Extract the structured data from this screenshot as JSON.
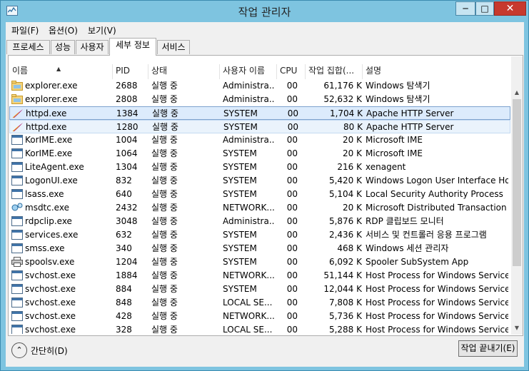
{
  "window": {
    "title": "작업 관리자"
  },
  "menu": {
    "file": "파일(F)",
    "options": "옵션(O)",
    "view": "보기(V)"
  },
  "tabs": [
    "프로세스",
    "성능",
    "사용자",
    "세부 정보",
    "서비스"
  ],
  "columns": {
    "name": "이름",
    "pid": "PID",
    "status": "상태",
    "user": "사용자 이름",
    "cpu": "CPU",
    "memory": "작업 집합(...",
    "description": "설명"
  },
  "processes": [
    {
      "name": "explorer.exe",
      "pid": "2688",
      "status": "실행 중",
      "user": "Administra...",
      "cpu": "00",
      "memory": "61,176 K",
      "description": "Windows 탐색기",
      "icon": "folder-icon"
    },
    {
      "name": "explorer.exe",
      "pid": "2808",
      "status": "실행 중",
      "user": "Administra...",
      "cpu": "00",
      "memory": "52,632 K",
      "description": "Windows 탐색기",
      "icon": "folder-icon"
    },
    {
      "name": "httpd.exe",
      "pid": "1384",
      "status": "실행 중",
      "user": "SYSTEM",
      "cpu": "00",
      "memory": "1,704 K",
      "description": "Apache HTTP Server",
      "icon": "apache-feather-icon"
    },
    {
      "name": "httpd.exe",
      "pid": "1280",
      "status": "실행 중",
      "user": "SYSTEM",
      "cpu": "00",
      "memory": "80 K",
      "description": "Apache HTTP Server",
      "icon": "apache-feather-icon"
    },
    {
      "name": "KorIME.exe",
      "pid": "1004",
      "status": "실행 중",
      "user": "Administra...",
      "cpu": "00",
      "memory": "20 K",
      "description": "Microsoft IME",
      "icon": "app-window-icon"
    },
    {
      "name": "KorIME.exe",
      "pid": "1064",
      "status": "실행 중",
      "user": "SYSTEM",
      "cpu": "00",
      "memory": "20 K",
      "description": "Microsoft IME",
      "icon": "app-window-icon"
    },
    {
      "name": "LiteAgent.exe",
      "pid": "1304",
      "status": "실행 중",
      "user": "SYSTEM",
      "cpu": "00",
      "memory": "216 K",
      "description": "xenagent",
      "icon": "app-window-icon"
    },
    {
      "name": "LogonUI.exe",
      "pid": "832",
      "status": "실행 중",
      "user": "SYSTEM",
      "cpu": "00",
      "memory": "5,420 K",
      "description": "Windows Logon User Interface Host",
      "icon": "app-window-icon"
    },
    {
      "name": "lsass.exe",
      "pid": "640",
      "status": "실행 중",
      "user": "SYSTEM",
      "cpu": "00",
      "memory": "5,104 K",
      "description": "Local Security Authority Process",
      "icon": "app-window-icon"
    },
    {
      "name": "msdtc.exe",
      "pid": "2432",
      "status": "실행 중",
      "user": "NETWORK...",
      "cpu": "00",
      "memory": "20 K",
      "description": "Microsoft Distributed Transaction ...",
      "icon": "network-icon"
    },
    {
      "name": "rdpclip.exe",
      "pid": "3048",
      "status": "실행 중",
      "user": "Administra...",
      "cpu": "00",
      "memory": "5,876 K",
      "description": "RDP 클립보드 모니터",
      "icon": "app-window-icon"
    },
    {
      "name": "services.exe",
      "pid": "632",
      "status": "실행 중",
      "user": "SYSTEM",
      "cpu": "00",
      "memory": "2,436 K",
      "description": "서비스 및 컨트롤러 응용 프로그램",
      "icon": "app-window-icon"
    },
    {
      "name": "smss.exe",
      "pid": "340",
      "status": "실행 중",
      "user": "SYSTEM",
      "cpu": "00",
      "memory": "468 K",
      "description": "Windows 세션 관리자",
      "icon": "app-window-icon"
    },
    {
      "name": "spoolsv.exe",
      "pid": "1204",
      "status": "실행 중",
      "user": "SYSTEM",
      "cpu": "00",
      "memory": "6,092 K",
      "description": "Spooler SubSystem App",
      "icon": "printer-icon"
    },
    {
      "name": "svchost.exe",
      "pid": "1884",
      "status": "실행 중",
      "user": "NETWORK...",
      "cpu": "00",
      "memory": "51,144 K",
      "description": "Host Process for Windows Services",
      "icon": "app-window-icon"
    },
    {
      "name": "svchost.exe",
      "pid": "884",
      "status": "실행 중",
      "user": "SYSTEM",
      "cpu": "00",
      "memory": "12,044 K",
      "description": "Host Process for Windows Services",
      "icon": "app-window-icon"
    },
    {
      "name": "svchost.exe",
      "pid": "848",
      "status": "실행 중",
      "user": "LOCAL SE...",
      "cpu": "00",
      "memory": "7,808 K",
      "description": "Host Process for Windows Services",
      "icon": "app-window-icon"
    },
    {
      "name": "svchost.exe",
      "pid": "428",
      "status": "실행 중",
      "user": "NETWORK...",
      "cpu": "00",
      "memory": "5,736 K",
      "description": "Host Process for Windows Services",
      "icon": "app-window-icon"
    },
    {
      "name": "svchost.exe",
      "pid": "328",
      "status": "실행 중",
      "user": "LOCAL SE...",
      "cpu": "00",
      "memory": "5,288 K",
      "description": "Host Process for Windows Services",
      "icon": "app-window-icon"
    }
  ],
  "footer": {
    "collapse": "간단히(D)",
    "end_task": "작업 끝내기(E)"
  }
}
